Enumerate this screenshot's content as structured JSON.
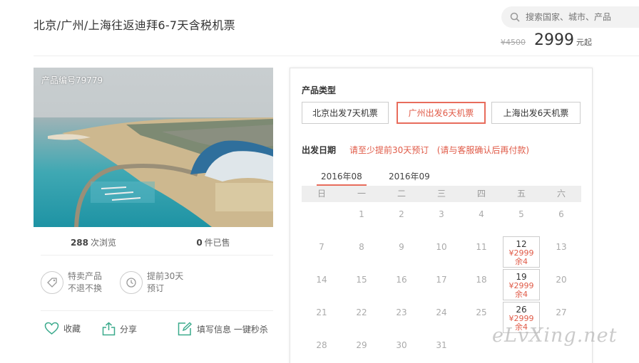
{
  "header": {
    "title": "北京/广州/上海往返迪拜6-7天含税机票",
    "search_placeholder": "搜索国家、城市、产品",
    "old_price": "¥4500",
    "price": "2999",
    "price_unit": "元起"
  },
  "photo": {
    "label": "产品编号79779"
  },
  "stats": {
    "views": "288",
    "views_label": "次浏览",
    "sold": "0",
    "sold_label": "件已售"
  },
  "badges": [
    {
      "line1": "特卖产品",
      "line2": "不退不换",
      "icon": "tag-icon"
    },
    {
      "line1": "提前30天",
      "line2": "预订",
      "icon": "clock-icon"
    }
  ],
  "actions": {
    "favorite": "收藏",
    "share": "分享",
    "fill": "填写信息 一键秒杀"
  },
  "booking": {
    "type_label": "产品类型",
    "types": [
      "北京出发7天机票",
      "广州出发6天机票",
      "上海出发6天机票"
    ],
    "active_type": 1,
    "date_label": "出发日期",
    "date_note": "请至少提前30天预订   (请与客服确认后再付款)",
    "months": [
      "2016年08",
      "2016年09"
    ],
    "weekdays": [
      "日",
      "一",
      "二",
      "三",
      "四",
      "五",
      "六"
    ],
    "weeks": [
      [
        "",
        "1",
        "2",
        "3",
        "4",
        "5",
        "6"
      ],
      [
        "7",
        "8",
        "9",
        "10",
        "11",
        "12",
        "13"
      ],
      [
        "14",
        "15",
        "16",
        "17",
        "18",
        "19",
        "20"
      ],
      [
        "21",
        "22",
        "23",
        "24",
        "25",
        "26",
        "27"
      ],
      [
        "28",
        "29",
        "30",
        "31",
        "",
        "",
        ""
      ]
    ],
    "available": {
      "12": {
        "price": "¥2999",
        "left": "余4"
      },
      "19": {
        "price": "¥2999",
        "left": "余4"
      },
      "26": {
        "price": "¥2999",
        "left": "余4"
      }
    }
  },
  "watermark": "eLvXing.net",
  "colors": {
    "accent": "#e86c5c",
    "green": "#3aaa8c"
  }
}
